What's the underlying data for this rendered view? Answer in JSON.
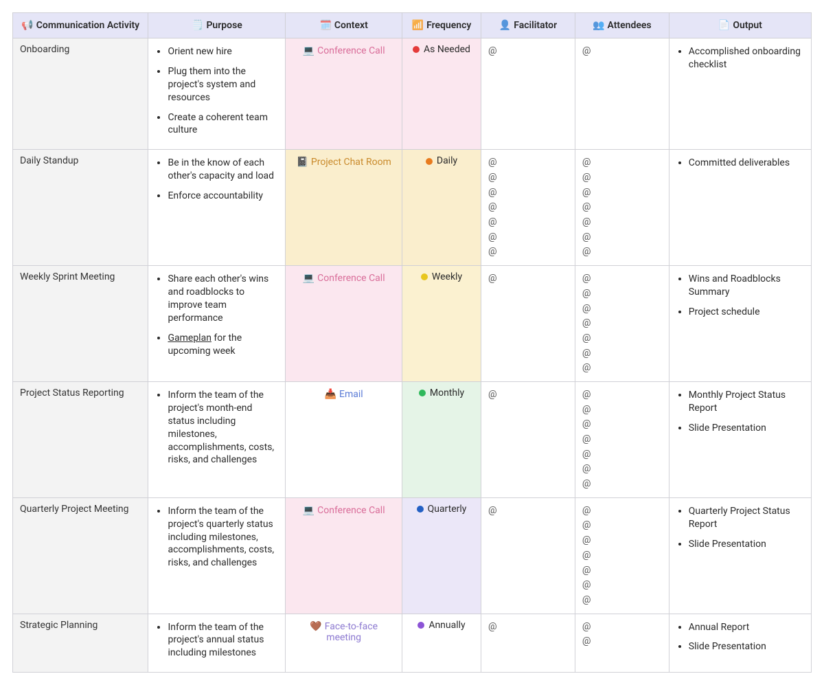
{
  "columns": [
    {
      "key": "activity",
      "label": "Communication Activity",
      "icon": "📢"
    },
    {
      "key": "purpose",
      "label": "Purpose",
      "icon": "🗒️"
    },
    {
      "key": "context",
      "label": "Context",
      "icon": "🗓️"
    },
    {
      "key": "frequency",
      "label": "Frequency",
      "icon": "📶"
    },
    {
      "key": "facilitator",
      "label": "Facilitator",
      "icon": "👤"
    },
    {
      "key": "attendees",
      "label": "Attendees",
      "icon": "👥"
    },
    {
      "key": "output",
      "label": "Output",
      "icon": "📄"
    }
  ],
  "rows": [
    {
      "activity": "Onboarding",
      "purpose": [
        "Orient new hire",
        "Plug them into the project's system and resources",
        "Create a coherent team culture"
      ],
      "context": {
        "label": "Conference Call",
        "icon": "💻",
        "bgClass": "bg-pink",
        "txtClass": "txt-pink"
      },
      "frequency": {
        "label": "As Needed",
        "color": "#e43b3b",
        "bgClass": "bg-pink"
      },
      "facilitator": [
        "@"
      ],
      "attendees": [
        "@"
      ],
      "output": [
        "Accomplished onboarding checklist"
      ]
    },
    {
      "activity": "Daily Standup",
      "purpose": [
        "Be in the know of each other's capacity and load",
        "Enforce accountability"
      ],
      "context": {
        "label": "Project Chat Room",
        "icon": "📓",
        "bgClass": "bg-orange",
        "txtClass": "txt-orange"
      },
      "frequency": {
        "label": "Daily",
        "color": "#e87b1e",
        "bgClass": "bg-orange"
      },
      "facilitator": [
        "@",
        "@",
        "@",
        "@",
        "@",
        "@",
        "@"
      ],
      "attendees": [
        "@",
        "@",
        "@",
        "@",
        "@",
        "@",
        "@"
      ],
      "output": [
        "Committed deliverables"
      ]
    },
    {
      "activity": "Weekly Sprint Meeting",
      "purpose": [
        "Share each other's wins and roadblocks to improve team performance",
        "Gameplan for the upcoming week"
      ],
      "underlineWords": [
        "Gameplan"
      ],
      "context": {
        "label": "Conference Call",
        "icon": "💻",
        "bgClass": "bg-pink",
        "txtClass": "txt-pink"
      },
      "frequency": {
        "label": "Weekly",
        "color": "#e8c61e",
        "bgClass": "bg-yellow"
      },
      "facilitator": [
        "@"
      ],
      "attendees": [
        "@",
        "@",
        "@",
        "@",
        "@",
        "@",
        "@"
      ],
      "output": [
        "Wins and Roadblocks Summary",
        "Project schedule"
      ]
    },
    {
      "activity": "Project Status Reporting",
      "purpose": [
        "Inform the team of the project's month-end status including milestones, accomplishments, costs, risks, and challenges"
      ],
      "context": {
        "label": "Email",
        "icon": "📥",
        "bgClass": "",
        "txtClass": "txt-blue"
      },
      "frequency": {
        "label": "Monthly",
        "color": "#2fb85b",
        "bgClass": "bg-green"
      },
      "facilitator": [
        "@"
      ],
      "attendees": [
        "@",
        "@",
        "@",
        "@",
        "@",
        "@",
        "@"
      ],
      "output": [
        "Monthly Project Status Report",
        "Slide Presentation"
      ]
    },
    {
      "activity": "Quarterly Project Meeting",
      "purpose": [
        "Inform the team of the project's quarterly status including milestones, accomplishments, costs, risks, and challenges"
      ],
      "context": {
        "label": "Conference Call",
        "icon": "💻",
        "bgClass": "bg-pink",
        "txtClass": "txt-pink"
      },
      "frequency": {
        "label": "Quarterly",
        "color": "#2360c4",
        "bgClass": "bg-purple"
      },
      "facilitator": [
        "@"
      ],
      "attendees": [
        "@",
        "@",
        "@",
        "@",
        "@",
        "@",
        "@"
      ],
      "output": [
        "Quarterly Project Status Report",
        "Slide Presentation"
      ]
    },
    {
      "activity": "Strategic Planning",
      "purpose": [
        "Inform the team of the project's annual status including milestones"
      ],
      "context": {
        "label": "Face-to-face meeting",
        "icon": "🤎",
        "bgClass": "",
        "txtClass": "txt-purple"
      },
      "frequency": {
        "label": "Annually",
        "color": "#8c54d6",
        "bgClass": ""
      },
      "facilitator": [
        "@"
      ],
      "attendees": [
        "@",
        "@"
      ],
      "output": [
        "Annual Report",
        "Slide Presentation"
      ]
    }
  ]
}
